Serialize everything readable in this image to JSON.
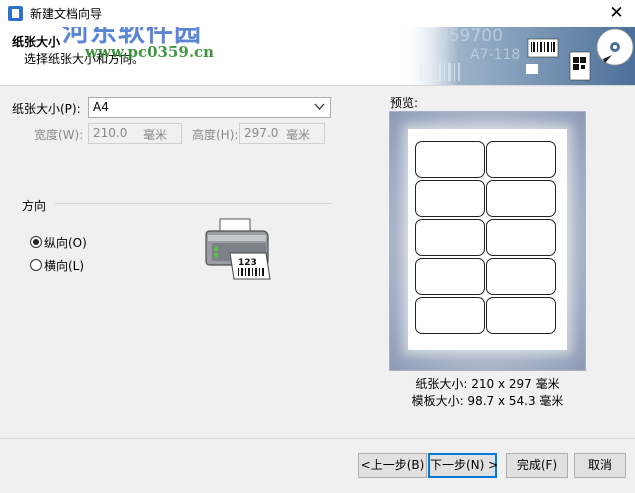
{
  "window": {
    "title": "新建文档向导",
    "close_glyph": "✕"
  },
  "header": {
    "title": "纸张大小",
    "subtitle": "选择纸张大小和方向。"
  },
  "watermark": {
    "text": "河东软件园",
    "url": "www.pc0359.cn"
  },
  "header_art_text": {
    "num1": "359700",
    "num2": "A7-118"
  },
  "paper": {
    "size_label": "纸张大小(P):",
    "size_value": "A4",
    "width_label": "宽度(W):",
    "width_value": "210.0",
    "width_unit": "毫米",
    "height_label": "高度(H):",
    "height_value": "297.0",
    "height_unit": "毫米"
  },
  "orientation": {
    "title": "方向",
    "portrait_label": "纵向(O)",
    "landscape_label": "横向(L)",
    "selected": "portrait",
    "printer_label_text": "123"
  },
  "preview": {
    "label": "预览:",
    "paper_size": "纸张大小: 210 x 297 毫米",
    "label_size": "模板大小: 98.7 x 54.3 毫米",
    "rows": 5,
    "cols": 2
  },
  "buttons": {
    "back": "<上一步(B)",
    "next": "下一步(N) >",
    "finish": "完成(F)",
    "cancel": "取消"
  }
}
